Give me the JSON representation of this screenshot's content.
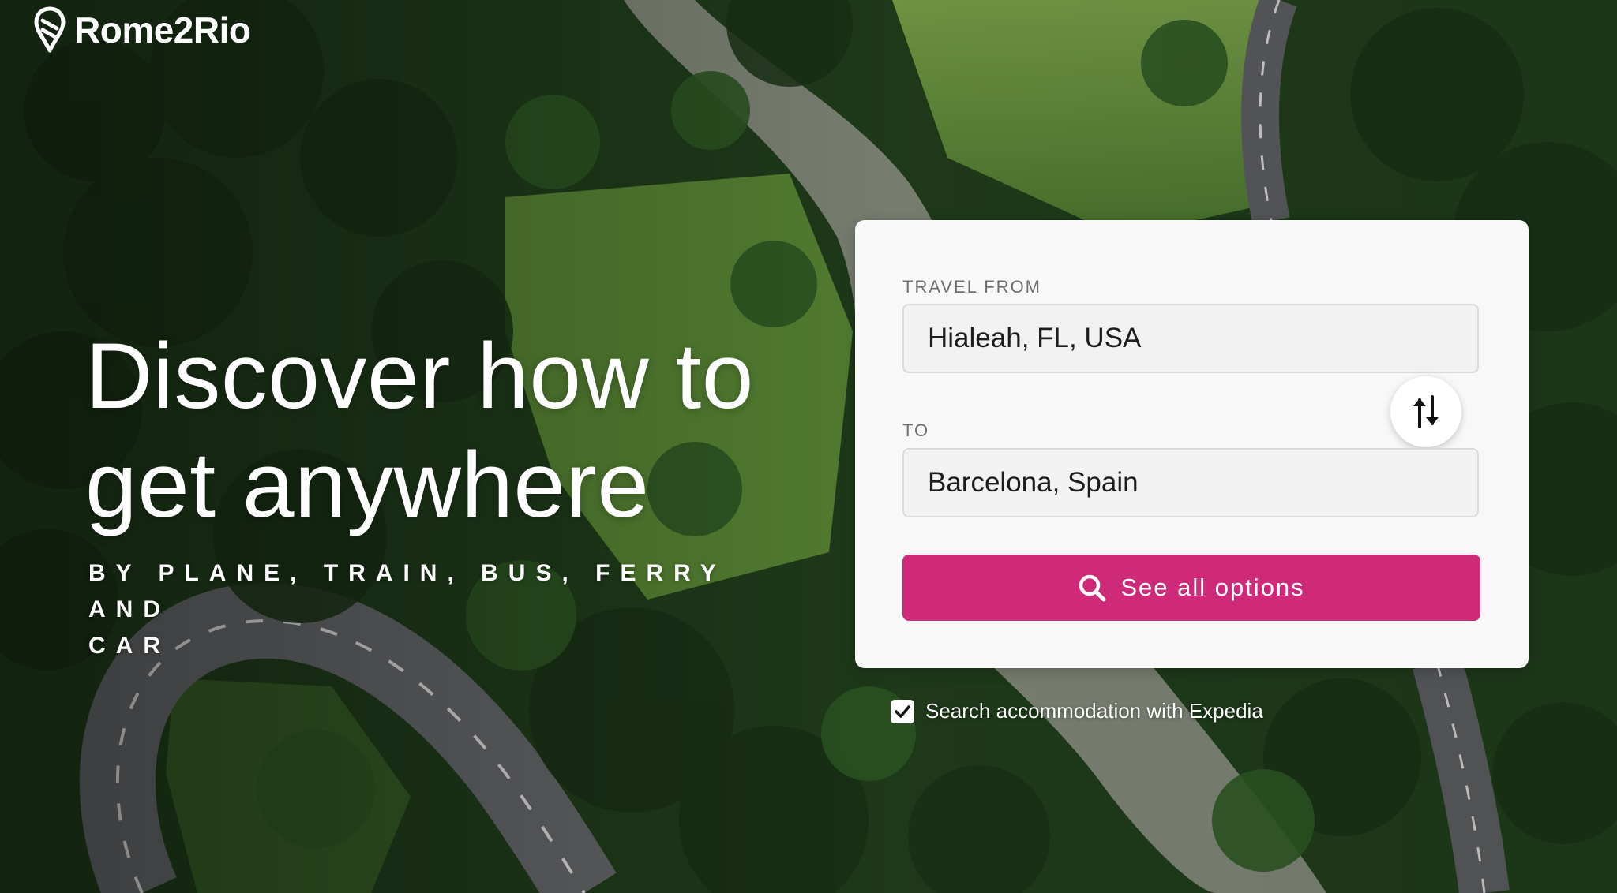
{
  "brand": {
    "name": "Rome2Rio",
    "logo_icon": "rome2rio-pin-logo-icon"
  },
  "hero": {
    "headline_line1": "Discover how to",
    "headline_line2": "get anywhere",
    "subline_line1": "BY PLANE, TRAIN, BUS, FERRY AND",
    "subline_line2": "CAR"
  },
  "search": {
    "from_label": "TRAVEL FROM",
    "from_value": "Hialeah, FL, USA",
    "to_label": "TO",
    "to_value": "Barcelona, Spain",
    "swap_icon": "swap-arrows-icon",
    "button_label": "See all options",
    "button_icon": "search-icon",
    "accommodation_label": "Search accommodation with Expedia",
    "accommodation_checked": true
  },
  "colors": {
    "accent": "#cf2a79",
    "card_background": "#f8f8f8",
    "label_text": "#6f6f6f"
  }
}
